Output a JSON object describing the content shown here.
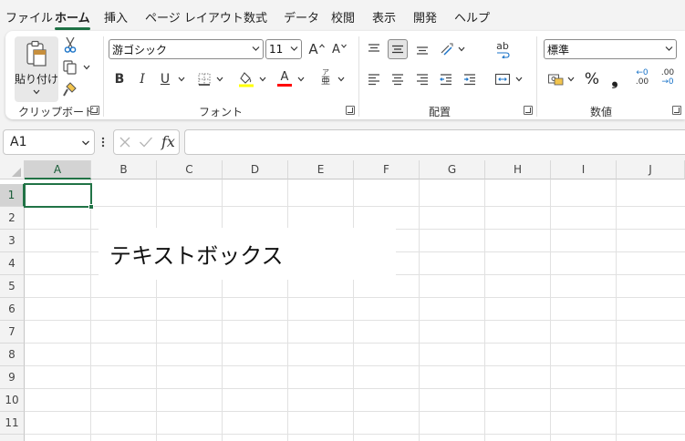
{
  "menu": {
    "tabs": [
      {
        "label": "ファイル"
      },
      {
        "label": "ホーム",
        "active": true
      },
      {
        "label": "挿入"
      },
      {
        "label": "ページ レイアウト"
      },
      {
        "label": "数式"
      },
      {
        "label": "データ"
      },
      {
        "label": "校閲"
      },
      {
        "label": "表示"
      },
      {
        "label": "開発"
      },
      {
        "label": "ヘルプ"
      }
    ]
  },
  "ribbon": {
    "clipboard": {
      "group_label": "クリップボード",
      "paste_label": "貼り付け",
      "icons": [
        "paste-icon",
        "cut-icon",
        "copy-icon",
        "format-painter-icon"
      ]
    },
    "font": {
      "group_label": "フォント",
      "font_name": "游ゴシック",
      "font_size": "11",
      "grow_label": "A",
      "shrink_label": "A",
      "bold_label": "B",
      "italic_label": "I",
      "underline_label": "U",
      "font_color_label": "A",
      "phonetic_label_top": "ア",
      "phonetic_label_bottom": "亜"
    },
    "alignment": {
      "group_label": "配置",
      "wrap_label": "ab"
    },
    "number": {
      "group_label": "数値",
      "format": "標準",
      "percent_label": "%",
      "comma_label": "❟",
      "increase_decimal_top": "←0",
      ".increase_decimal_bottom": ".00",
      "decrease_decimal_top": ".00",
      "decrease_decimal_bottom": "→0"
    }
  },
  "formula_bar": {
    "name_box": "A1",
    "fx_label": "fx",
    "formula": ""
  },
  "sheet": {
    "columns": [
      "A",
      "B",
      "C",
      "D",
      "E",
      "F",
      "G",
      "H",
      "I",
      "J"
    ],
    "rows": [
      "1",
      "2",
      "3",
      "4",
      "5",
      "6",
      "7",
      "8",
      "9",
      "10",
      "11"
    ],
    "active_cell": "A1",
    "textbox_text": "テキストボックス"
  },
  "colors": {
    "accent": "#217346",
    "fill_color_bar": "#ffff00",
    "font_color_bar": "#ff0000"
  }
}
